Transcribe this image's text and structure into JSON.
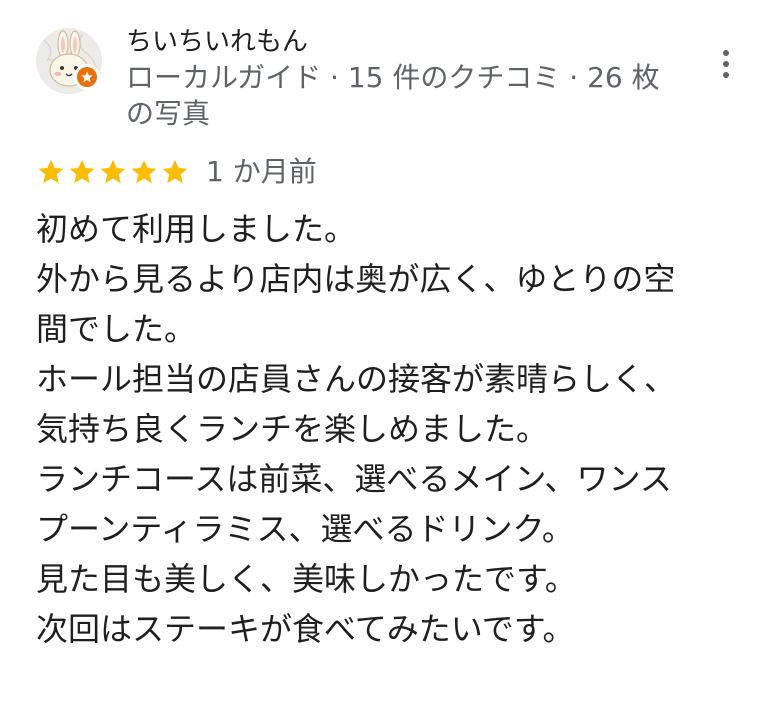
{
  "author": {
    "name": "ちいちいれもん",
    "meta": "ローカルガイド · 15 件のクチコミ · 26 枚の写真",
    "avatar_icon": "bunny-avatar-icon",
    "badge_icon": "local-guide-star-icon",
    "badge_color": "#e8710a"
  },
  "more_icon": "more-vert-icon",
  "rating": {
    "stars": 5,
    "max_stars": 5,
    "star_color": "#fbbc04",
    "time": "1 か月前"
  },
  "review": {
    "lines": [
      "初めて利用しました。",
      "外から見るより店内は奥が広く、ゆとりの空",
      "間でした。",
      "ホール担当の店員さんの接客が素晴らしく、",
      "気持ち良くランチを楽しめました。",
      "ランチコースは前菜、選べるメイン、ワンス",
      "プーンティラミス、選べるドリンク。",
      "見た目も美しく、美味しかったです。",
      "次回はステーキが食べてみたいです。"
    ]
  }
}
